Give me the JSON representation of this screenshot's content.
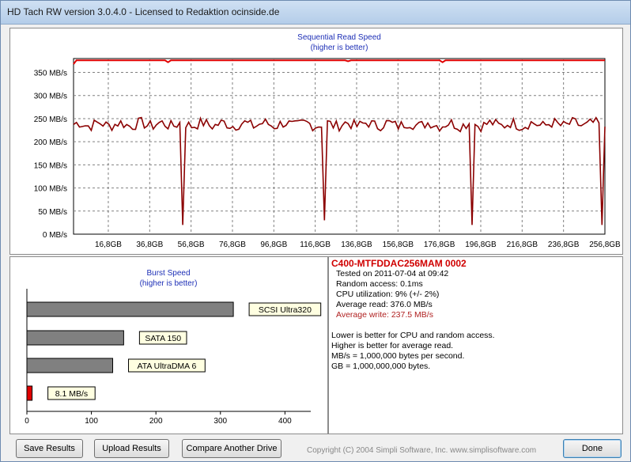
{
  "window": {
    "title": "HD Tach RW version 3.0.4.0 - Licensed to Redaktion ocinside.de"
  },
  "chart_data": [
    {
      "type": "line",
      "title": "Sequential Read Speed",
      "subtitle": "(higher is better)",
      "ylim": [
        0,
        380
      ],
      "y_ticks": [
        0,
        50,
        100,
        150,
        200,
        250,
        300,
        350
      ],
      "y_tick_labels": [
        "0 MB/s",
        "50 MB/s",
        "100 MB/s",
        "150 MB/s",
        "200 MB/s",
        "250 MB/s",
        "300 MB/s",
        "350 MB/s"
      ],
      "xlim": [
        0,
        256.8
      ],
      "x_ticks": [
        16.8,
        36.8,
        56.8,
        76.8,
        96.8,
        116.8,
        136.8,
        156.8,
        176.8,
        196.8,
        216.8,
        236.8,
        256.8
      ],
      "x_tick_labels": [
        "16,8GB",
        "36,8GB",
        "56,8GB",
        "76,8GB",
        "96,8GB",
        "116,8GB",
        "136,8GB",
        "156,8GB",
        "176,8GB",
        "196,8GB",
        "216,8GB",
        "236,8GB",
        "256,8GB"
      ],
      "grid": true,
      "series": [
        {
          "color": "#e00000",
          "baseline": 376,
          "dips": [
            [
              0,
              368
            ],
            [
              46,
              372
            ],
            [
              133,
              374
            ],
            [
              178,
              372
            ]
          ]
        },
        {
          "color": "#8b0000",
          "baseline": 237.5,
          "noise": 12,
          "dips": [
            [
              53,
              20
            ],
            [
              121,
              30
            ],
            [
              192,
              20
            ],
            [
              255,
              20
            ]
          ]
        }
      ]
    },
    {
      "type": "bar",
      "title": "Burst Speed",
      "subtitle": "(higher is better)",
      "xlim": [
        0,
        440
      ],
      "x_ticks": [
        0,
        100,
        200,
        300,
        400
      ],
      "x_tick_labels": [
        "0",
        "100",
        "200",
        "300",
        "400"
      ],
      "bars": [
        {
          "label": "SCSI Ultra320",
          "value": 320,
          "color": "#808080"
        },
        {
          "label": "SATA 150",
          "value": 150,
          "color": "#808080"
        },
        {
          "label": "ATA UltraDMA 6",
          "value": 133,
          "color": "#808080"
        },
        {
          "label": "8.1 MB/s",
          "value": 8.1,
          "color": "#e00000"
        }
      ]
    }
  ],
  "info": {
    "drive": "C400-MTFDDAC256MAM 0002",
    "tested": "Tested on 2011-07-04 at 09:42",
    "random_access": "Random access: 0.1ms",
    "cpu": "CPU utilization: 9% (+/- 2%)",
    "avg_read": "Average read: 376.0 MB/s",
    "avg_write": "Average write: 237.5 MB/s",
    "note1": "Lower is better for CPU and random access.",
    "note2": "Higher is better for average read.",
    "note3": "MB/s = 1,000,000 bytes per second.",
    "note4": "GB = 1,000,000,000 bytes."
  },
  "buttons": {
    "save": "Save Results",
    "upload": "Upload Results",
    "compare": "Compare Another Drive",
    "done": "Done"
  },
  "copyright": "Copyright (C) 2004 Simpli Software, Inc. www.simplisoftware.com"
}
